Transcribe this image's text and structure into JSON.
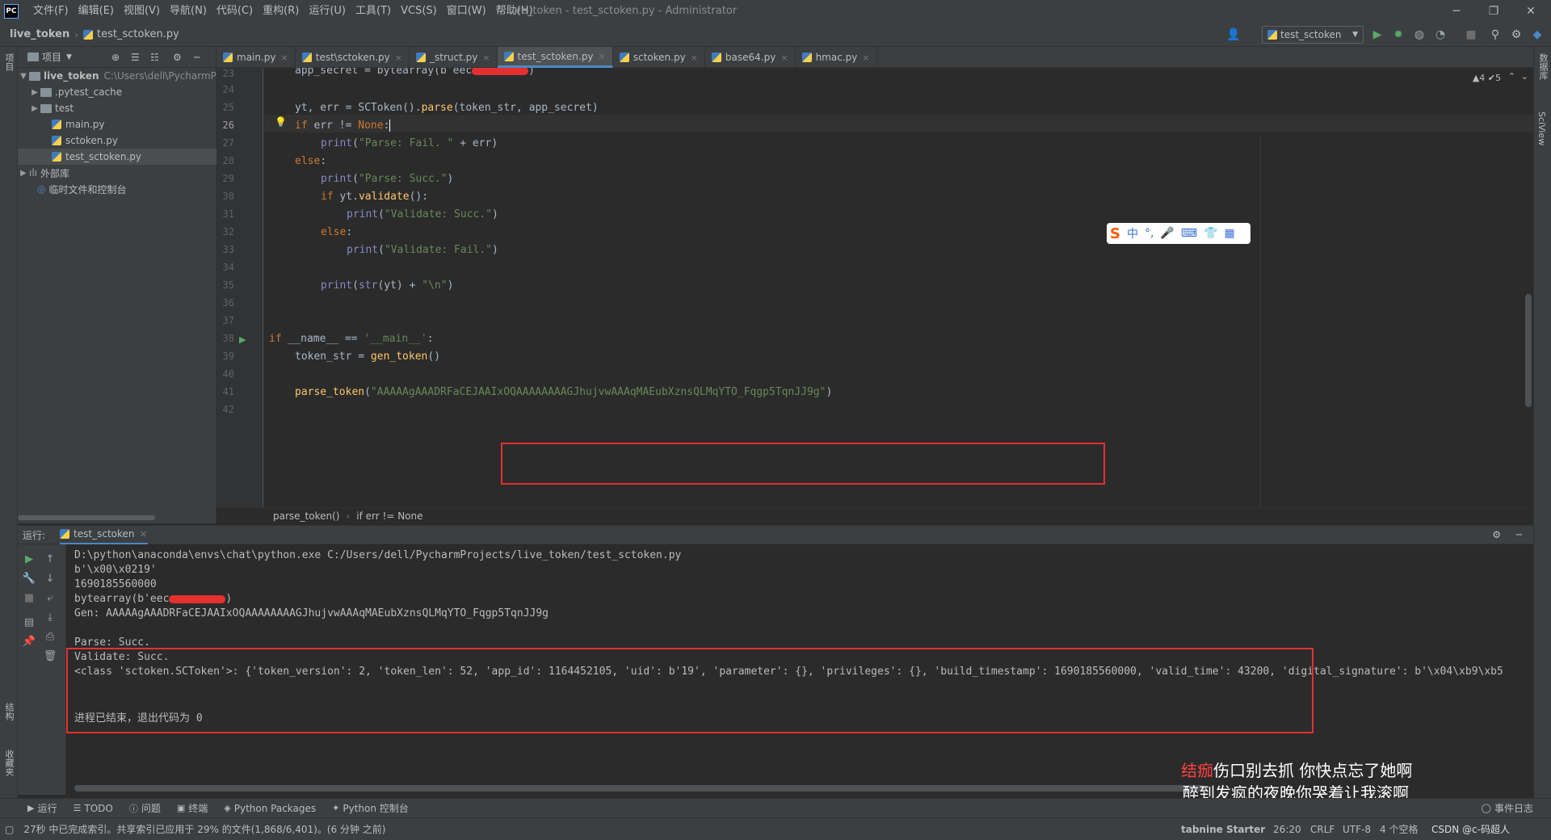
{
  "titlebar": {
    "logo": "PC",
    "menu": [
      "文件(F)",
      "编辑(E)",
      "视图(V)",
      "导航(N)",
      "代码(C)",
      "重构(R)",
      "运行(U)",
      "工具(T)",
      "VCS(S)",
      "窗口(W)",
      "帮助(H)"
    ],
    "title": "live_token - test_sctoken.py - Administrator"
  },
  "navbar": {
    "project": "live_token",
    "file": "test_sctoken.py",
    "run_config": "test_sctoken"
  },
  "left_strip": {
    "project_label": "项目",
    "structure_label": "结构",
    "bookmarks_label": "收藏夹"
  },
  "right_strip": {
    "db_label": "数据库",
    "sciview_label": "SciView"
  },
  "project_panel": {
    "header": "项目",
    "root_name": "live_token",
    "root_path": "C:\\Users\\dell\\PycharmP",
    "items": [
      {
        "label": ".pytest_cache"
      },
      {
        "label": "test"
      },
      {
        "label": "main.py"
      },
      {
        "label": "sctoken.py"
      },
      {
        "label": "test_sctoken.py"
      },
      {
        "label": "外部库"
      },
      {
        "label": "临时文件和控制台"
      }
    ]
  },
  "editor_tabs": [
    "main.py",
    "test\\sctoken.py",
    "_struct.py",
    "test_sctoken.py",
    "sctoken.py",
    "base64.py",
    "hmac.py"
  ],
  "editor": {
    "inspection": "▲4 ✔5",
    "lines": [
      "23",
      "24",
      "25",
      "26",
      "27",
      "28",
      "29",
      "30",
      "31",
      "32",
      "33",
      "34",
      "35",
      "36",
      "37",
      "38",
      "39",
      "40",
      "41",
      "42"
    ],
    "code": {
      "l23": "app_secret = bytearray(b'eec",
      "l23_end": ")",
      "l25a": "yt, err = ",
      "l25b": "SCToken",
      "l25c": "().",
      "l25d": "parse",
      "l25e": "(token_str, app_secret)",
      "l26_if": "if ",
      "l26_mid": "err != ",
      "l26_none": "None",
      "l26_colon": ":",
      "l27a": "print",
      "l27b": "(",
      "l27c": "\"Parse: Fail. \"",
      "l27d": " + err)",
      "l28": "else",
      "l28c": ":",
      "l29a": "print",
      "l29b": "(",
      "l29c": "\"Parse: Succ.\"",
      "l29d": ")",
      "l30a": "if ",
      "l30b": "yt.",
      "l30c": "validate",
      "l30d": "():",
      "l31a": "print",
      "l31b": "(",
      "l31c": "\"Validate: Succ.\"",
      "l31d": ")",
      "l32": "else",
      "l32c": ":",
      "l33a": "print",
      "l33b": "(",
      "l33c": "\"Validate: Fail.\"",
      "l33d": ")",
      "l35a": "print",
      "l35b": "(",
      "l35c": "str",
      "l35d": "(yt) + ",
      "l35e": "\"\\n\"",
      "l35f": ")",
      "l38a": "if ",
      "l38b": "__name__ == ",
      "l38c": "'__main__'",
      "l38d": ":",
      "l39a": "token_str = ",
      "l39b": "gen_token",
      "l39c": "()",
      "l41a": "parse_token",
      "l41b": "(",
      "l41c": "\"AAAAAgAAADRFaCEJAAIxOQAAAAAAAAGJhujvwAAAqMAEubXznsQLMqYTO_Fqgp5TqnJJ9g\"",
      "l41d": ")"
    },
    "breadcrumb": [
      "parse_token()",
      "if err != None"
    ]
  },
  "run": {
    "label": "运行:",
    "tab": "test_sctoken",
    "output": [
      "D:\\python\\anaconda\\envs\\chat\\python.exe C:/Users/dell/PycharmProjects/live_token/test_sctoken.py",
      "b'\\x00\\x0219'",
      "1690185560000",
      "bytearray(b'eec",
      "Gen: AAAAAgAAADRFaCEJAAIxOQAAAAAAAAGJhujvwAAAqMAEubXznsQLMqYTO_Fqgp5TqnJJ9g",
      "Parse: Succ.",
      "Validate: Succ.",
      "<class 'sctoken.SCToken'>: {'token_version': 2, 'token_len': 52, 'app_id': 1164452105, 'uid': b'19', 'parameter': {}, 'privileges': {}, 'build_timestamp': 1690185560000, 'valid_time': 43200, 'digital_signature': b'\\x04\\xb9\\xb5",
      "进程已结束，退出代码为 0"
    ],
    "bytearray_end": ")"
  },
  "bottom_tools": [
    "运行",
    "TODO",
    "问题",
    "终端",
    "Python Packages",
    "Python 控制台",
    "事件日志"
  ],
  "statusbar": {
    "message": "27秒 中已完成索引。共享索引已应用于 29% 的文件(1,868/6,401)。(6 分钟 之前)",
    "tabnine": "tabnine Starter",
    "position": "26:20",
    "line_sep": "CRLF",
    "encoding": "UTF-8",
    "indent": "4 个空格",
    "watermark": "CSDN @c-码超人"
  },
  "ime": {
    "lang": "中",
    "punct": "°,"
  },
  "lyrics": {
    "line1_hl": "结痂",
    "line1_rest": "伤口别去抓 你快点忘了她啊",
    "line2": "醉到发疯的夜晚你哭着让我滚啊"
  },
  "colors": {
    "accent": "#4a88c7",
    "highlight_box": "#e53030",
    "keyword": "#cc7832",
    "string": "#6a8759",
    "function": "#ffc66d"
  }
}
